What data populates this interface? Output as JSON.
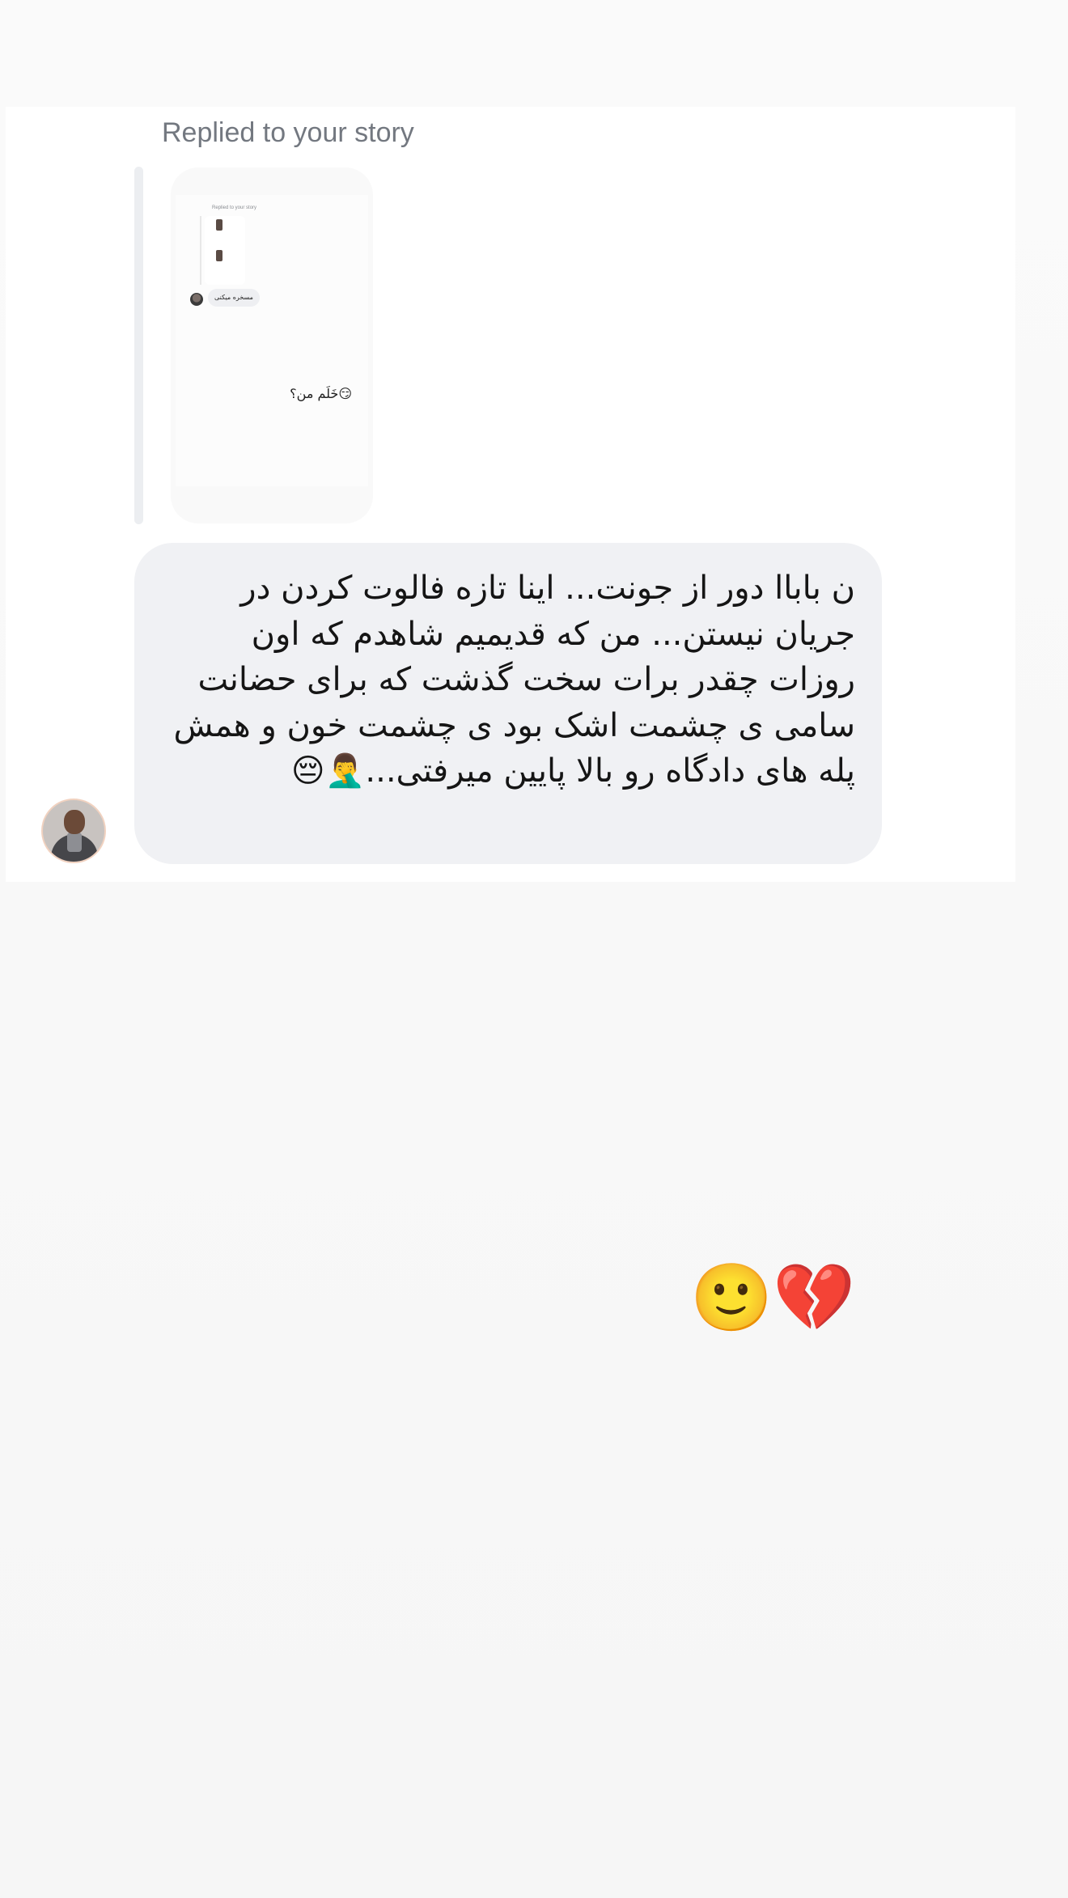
{
  "reply": {
    "label": "Replied to your story"
  },
  "story_preview": {
    "mini_label": "Replied to your story",
    "mini_bubble": "مسخره میکنی",
    "mini_text": "خَلَم من؟😏"
  },
  "message": {
    "text": "ن باباا دور از جونت... اینا تازه فالوت کردن در جریان نیستن... من که قدیمیم شاهدم که اون روزات چقدر برات سخت گذشت که برای حضانت سامی ی چشمت اشک بود ی چشمت خون و همش پله های دادگاه رو بالا پایین میرفتی...🤦‍♂️😔"
  },
  "reaction": {
    "emojis": "🙂💔"
  }
}
